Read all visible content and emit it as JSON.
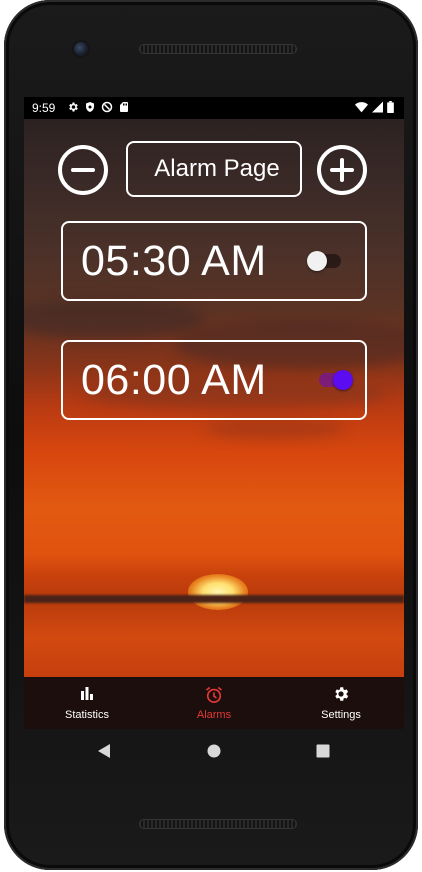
{
  "status_bar": {
    "time": "9:59",
    "left_icons": [
      "gear-icon",
      "shield-icon",
      "do-not-disturb-icon",
      "sd-card-icon"
    ],
    "right_icons": [
      "wifi-icon",
      "signal-icon",
      "battery-icon"
    ]
  },
  "header": {
    "title": "Alarm Page",
    "remove_button_icon": "minus-circle-icon",
    "add_button_icon": "plus-circle-icon"
  },
  "alarms": [
    {
      "time": "05:30 AM",
      "enabled": false
    },
    {
      "time": "06:00 AM",
      "enabled": true
    }
  ],
  "bottom_nav": {
    "items": [
      {
        "label": "Statistics",
        "icon": "bar-chart-icon",
        "active": false
      },
      {
        "label": "Alarms",
        "icon": "alarm-clock-icon",
        "active": true
      },
      {
        "label": "Settings",
        "icon": "gear-icon",
        "active": false
      }
    ],
    "active_color": "#e53935",
    "inactive_color": "#ffffff"
  },
  "colors": {
    "switch_on_thumb": "#5b0cf0",
    "switch_off_thumb": "#f1f1f1",
    "nav_background": "#1b0e0c"
  }
}
